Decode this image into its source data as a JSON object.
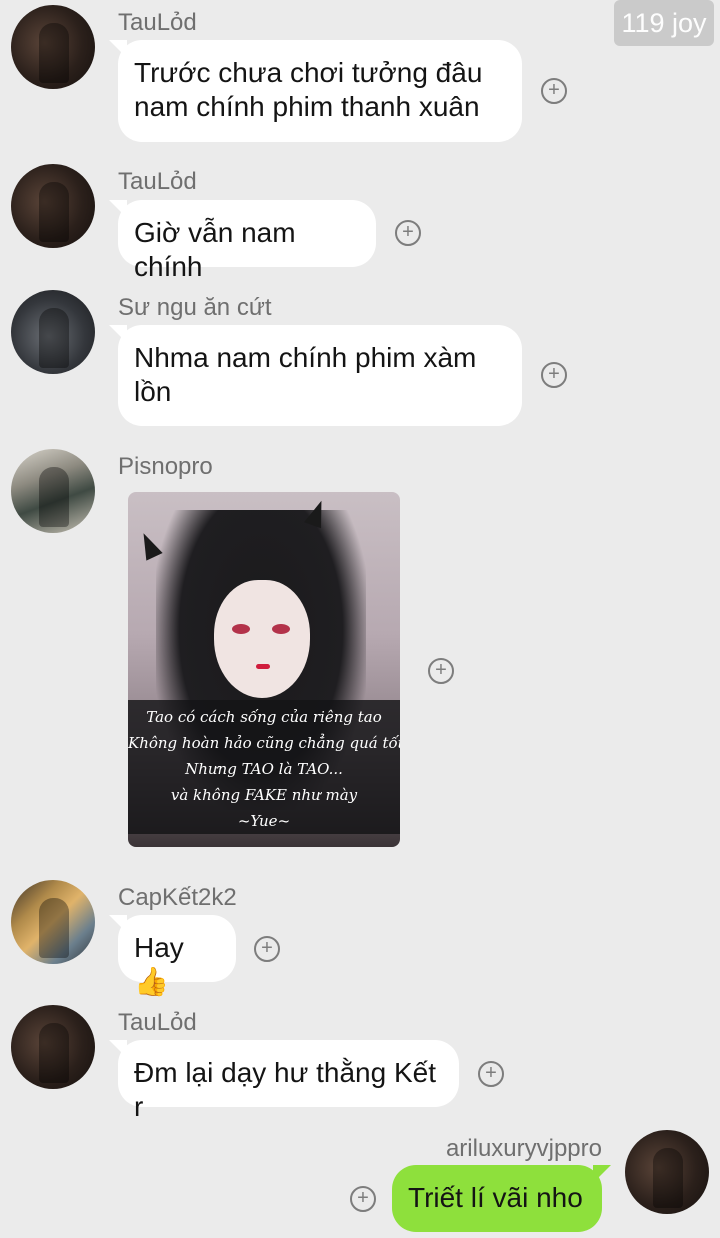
{
  "badge": {
    "text": "119 joy"
  },
  "messages": [
    {
      "sender": "TauLỏd",
      "text_lines": [
        "Trước chưa chơi tưởng đâu",
        "nam chính phim thanh xuân"
      ]
    },
    {
      "sender": "TauLỏd",
      "text": "Giờ vẫn nam chính"
    },
    {
      "sender": "Sư ngu ăn cứt",
      "text_lines": [
        "Nhma nam chính phim xàm",
        "lồn"
      ]
    },
    {
      "sender": "Pisnopro",
      "image_caption": [
        "Tao có cách sống của riêng tao",
        "Không hoàn hảo cũng chẳng quá tốt",
        "Nhưng TAO là TAO...",
        "và không FAKE như mày",
        "~Yue~"
      ]
    },
    {
      "sender": "CapKết2k2",
      "text": "Hay 👍"
    },
    {
      "sender": "TauLỏd",
      "text": "Đm lại dạy hư thằng Kết r"
    }
  ],
  "self": {
    "sender": "ariluxuryvjppro",
    "text": "Triết lí vãi nho"
  },
  "icons": {
    "plus": "+"
  }
}
